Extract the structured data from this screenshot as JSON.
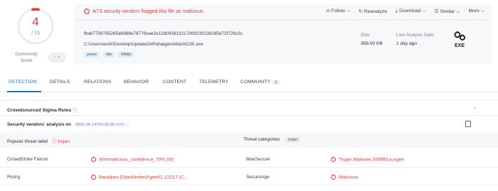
{
  "score": {
    "detections": "4",
    "total": "/ 73",
    "community_label": "Community Score",
    "community_toggle": "✓ ✕",
    "ratio": 0.055,
    "ring_color": "#e53935"
  },
  "banner": {
    "flag_text": "4/73 security vendors flagged this file as malicious",
    "flag_icon": "!",
    "actions": [
      {
        "icon": "bell-icon",
        "glyph": "⍾",
        "label": "Follow ⌵"
      },
      {
        "icon": "refresh-icon",
        "glyph": "↻",
        "label": "Reanalyze"
      },
      {
        "icon": "download-icon",
        "glyph": "⤓",
        "label": "Download ⌵"
      },
      {
        "icon": "similar-icon",
        "glyph": "☰",
        "label": "Similar ⌵"
      },
      {
        "icon": "more-icon",
        "glyph": "",
        "label": "More ⌵"
      }
    ]
  },
  "file": {
    "hash": "fbab7758765265a6988e78779cae2e12d093813217d09230136185d72f726c3c",
    "path": "C:\\Users\\work\\Desktop\\UpdateOnPahalgamAttachOJK.exe",
    "tags": [
      "peexe",
      "idle",
      "64bits"
    ],
    "size_label": "Size",
    "size_value": "358.00 KB",
    "date_label": "Last Analysis Date",
    "date_value": "1 day ago",
    "type_label": "EXE"
  },
  "tabs": [
    {
      "label": "DETECTION",
      "active": true
    },
    {
      "label": "DETAILS"
    },
    {
      "label": "RELATIONS"
    },
    {
      "label": "BEHAVIOR"
    },
    {
      "label": "CONTENT"
    },
    {
      "label": "TELEMETRY"
    },
    {
      "label": "COMMUNITY",
      "badge": "1"
    }
  ],
  "sigma": {
    "title": "Crowdsourced Sigma Rules",
    "info_icon": "ⓘ"
  },
  "vendors_analysis": {
    "title": "Security vendors' analysis on",
    "date": "2025-05-14T02:20:35 UTC ⌵"
  },
  "threat": {
    "label_title": "Popular threat label",
    "label_value": "trojan.",
    "categories_title": "Threat categories",
    "categories_value": "trojan"
  },
  "detections": [
    {
      "vendor": "CrowdStrike Falcon",
      "result": "Win/malicious_confidence_70% (W)",
      "vendor2": "MaxSecure",
      "result2": "Trojan.Malware.300983.susgen"
    },
    {
      "vendor": "Rising",
      "result": "Backdoor.[SideWinder]Agent!1.12D17 (C...",
      "vendor2": "SecureAge",
      "result2": "Malicious"
    }
  ]
}
